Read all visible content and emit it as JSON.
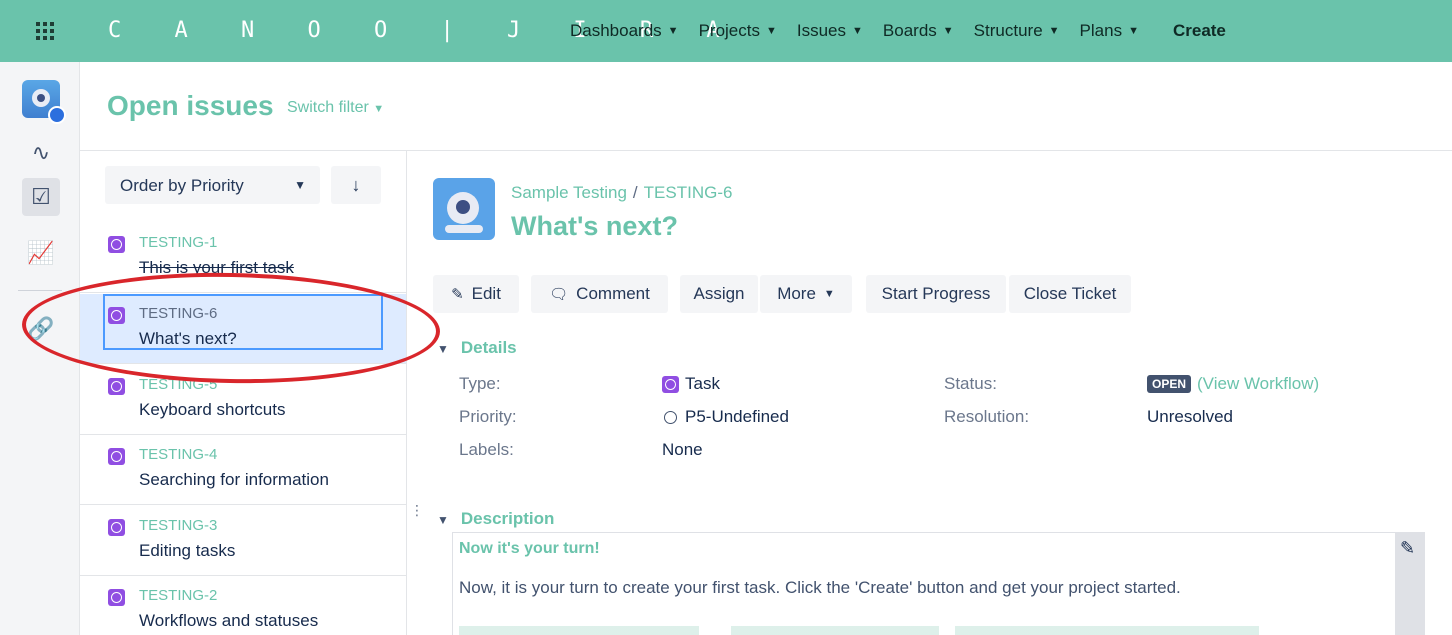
{
  "brand": "C A N O O | J I R A",
  "nav": {
    "items": [
      "Dashboards",
      "Projects",
      "Issues",
      "Boards",
      "Structure",
      "Plans"
    ],
    "create": "Create"
  },
  "page": {
    "title": "Open issues",
    "switch_filter": "Switch filter"
  },
  "list": {
    "order_by": "Order by Priority",
    "order_dir": "↓",
    "items": [
      {
        "key": "TESTING-1",
        "summary": "This is your first task"
      },
      {
        "key": "TESTING-6",
        "summary": "What's next?"
      },
      {
        "key": "TESTING-5",
        "summary": "Keyboard shortcuts"
      },
      {
        "key": "TESTING-4",
        "summary": "Searching for information"
      },
      {
        "key": "TESTING-3",
        "summary": "Editing tasks"
      },
      {
        "key": "TESTING-2",
        "summary": "Workflows and statuses"
      }
    ]
  },
  "issue": {
    "project": "Sample Testing",
    "key": "TESTING-6",
    "title": "What's next?",
    "buttons": {
      "edit": "Edit",
      "comment": "Comment",
      "assign": "Assign",
      "more": "More",
      "start_progress": "Start Progress",
      "close_ticket": "Close Ticket"
    },
    "details_label": "Details",
    "fields": {
      "type_label": "Type:",
      "type_value": "Task",
      "priority_label": "Priority:",
      "priority_value": "P5-Undefined",
      "labels_label": "Labels:",
      "labels_value": "None",
      "status_label": "Status:",
      "status_value": "OPEN",
      "view_workflow": "(View Workflow)",
      "resolution_label": "Resolution:",
      "resolution_value": "Unresolved"
    },
    "description_label": "Description",
    "description": {
      "heading": "Now it's your turn!",
      "text": "Now, it is your turn to create your first task. Click the 'Create' button and get your project started."
    }
  },
  "colors": {
    "brand": "#6ac3ab",
    "annotation": "#d9262b",
    "task_icon": "#904ee2",
    "selected_bg": "#deebff"
  }
}
